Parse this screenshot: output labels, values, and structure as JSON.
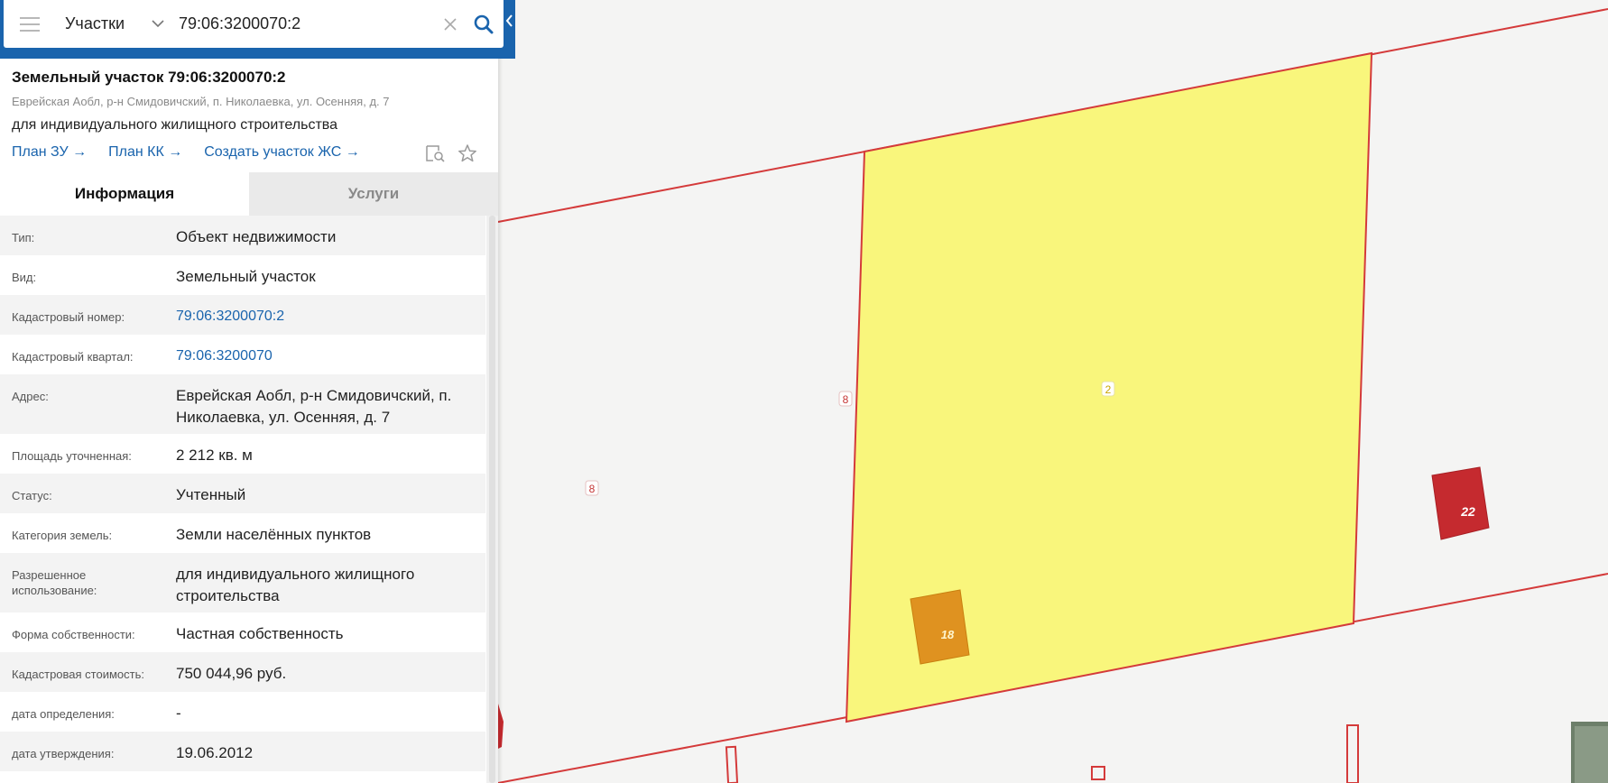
{
  "search": {
    "layer": "Участки",
    "query": "79:06:3200070:2"
  },
  "object": {
    "title": "Земельный участок 79:06:3200070:2",
    "address": "Еврейская Аобл, р-н Смидовичский, п. Николаевка, ул. Осенняя, д. 7",
    "purpose": "для индивидуального жилищного строительства",
    "links": [
      "План ЗУ →",
      "План КК →",
      "Создать участок ЖС →"
    ]
  },
  "tabs": [
    "Информация",
    "Услуги"
  ],
  "rows": [
    {
      "label": "Тип:",
      "value": "Объект недвижимости"
    },
    {
      "label": "Вид:",
      "value": "Земельный участок"
    },
    {
      "label": "Кадастровый номер:",
      "value": "79:06:3200070:2"
    },
    {
      "label": "Кадастровый квартал:",
      "value": "79:06:3200070"
    },
    {
      "label": "Адрес:",
      "value": "Еврейская Аобл, р-н Смидовичский, п. Николаевка, ул. Осенняя, д. 7"
    },
    {
      "label": "Площадь уточненная:",
      "value": "2 212 кв. м"
    },
    {
      "label": "Статус:",
      "value": "Учтенный"
    },
    {
      "label": "Категория земель:",
      "value": "Земли населённых пунктов"
    },
    {
      "label": "Разрешенное использование:",
      "value": "для индивидуального жилищного строительства"
    },
    {
      "label": "Форма собственности:",
      "value": "Частная собственность"
    },
    {
      "label": "Кадастровая стоимость:",
      "value": "750 044,96 руб."
    },
    {
      "label": "дата определения:",
      "value": "-"
    },
    {
      "label": "дата утверждения:",
      "value": "19.06.2012"
    }
  ],
  "map": {
    "labels": {
      "parcel_main": "2",
      "parcel_left_border": "8",
      "parcel_left": "8",
      "building_orange": "18",
      "building_red": "22"
    },
    "colors": {
      "boundary": "#d43a3a",
      "parcel_fill": "#f9f67c",
      "building_orange": "#df9220",
      "building_red": "#c52a2f",
      "accent": "#1a64ad"
    }
  }
}
